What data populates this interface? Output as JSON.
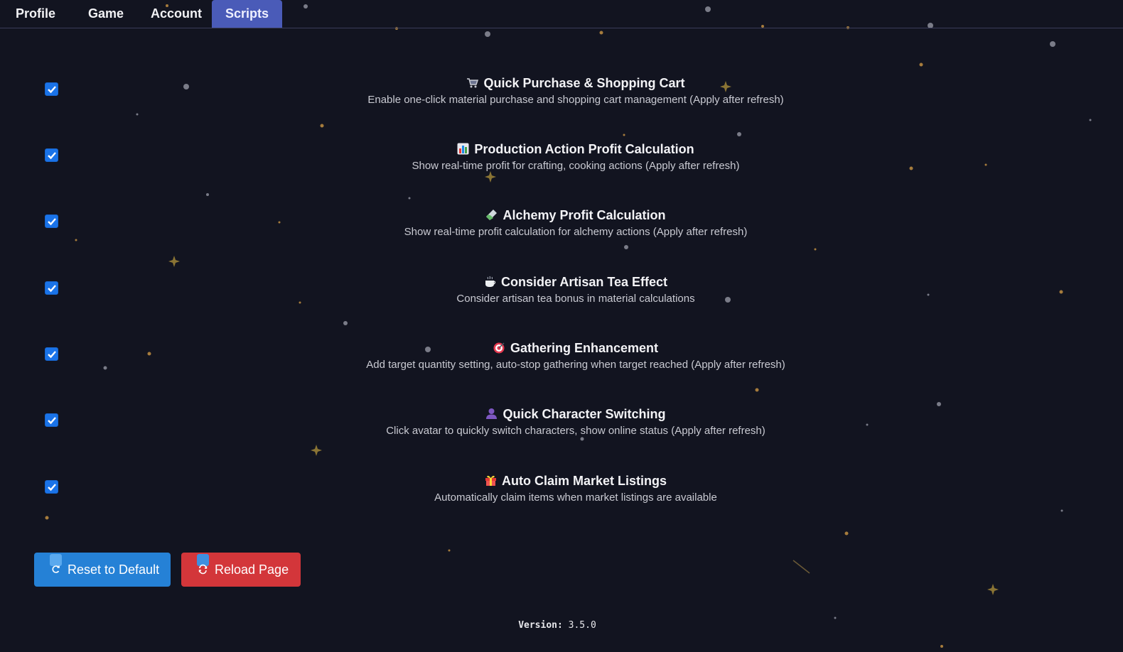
{
  "tabs": [
    {
      "label": "Profile",
      "active": false
    },
    {
      "label": "Game",
      "active": false
    },
    {
      "label": "Account",
      "active": false
    },
    {
      "label": "Scripts",
      "active": true
    }
  ],
  "settings": [
    {
      "icon": "shopping-cart-icon",
      "title": "Quick Purchase & Shopping Cart",
      "description": "Enable one-click material purchase and shopping cart management (Apply after refresh)",
      "checked": true
    },
    {
      "icon": "bar-chart-icon",
      "title": "Production Action Profit Calculation",
      "description": "Show real-time profit for crafting, cooking actions (Apply after refresh)",
      "checked": true
    },
    {
      "icon": "test-tube-icon",
      "title": "Alchemy Profit Calculation",
      "description": "Show real-time profit calculation for alchemy actions (Apply after refresh)",
      "checked": true
    },
    {
      "icon": "tea-cup-icon",
      "title": "Consider Artisan Tea Effect",
      "description": "Consider artisan tea bonus in material calculations",
      "checked": true
    },
    {
      "icon": "target-icon",
      "title": "Gathering Enhancement",
      "description": "Add target quantity setting, auto-stop gathering when target reached (Apply after refresh)",
      "checked": true
    },
    {
      "icon": "user-icon",
      "title": "Quick Character Switching",
      "description": "Click avatar to quickly switch characters, show online status (Apply after refresh)",
      "checked": true
    },
    {
      "icon": "gift-icon",
      "title": "Auto Claim Market Listings",
      "description": "Automatically claim items when market listings are available",
      "checked": true
    }
  ],
  "buttons": {
    "reset_label": "Reset to Default",
    "reset_icon": "refresh-icon",
    "reload_label": "Reload Page",
    "reload_icon": "reload-icon"
  },
  "version": {
    "label": "Version:",
    "value": "3.5.0"
  },
  "colors": {
    "background": "#121420",
    "active_tab": "#4a5bb8",
    "checkbox": "#1a73e8",
    "reset_button": "#2581d6",
    "reload_button": "#d3363a"
  }
}
